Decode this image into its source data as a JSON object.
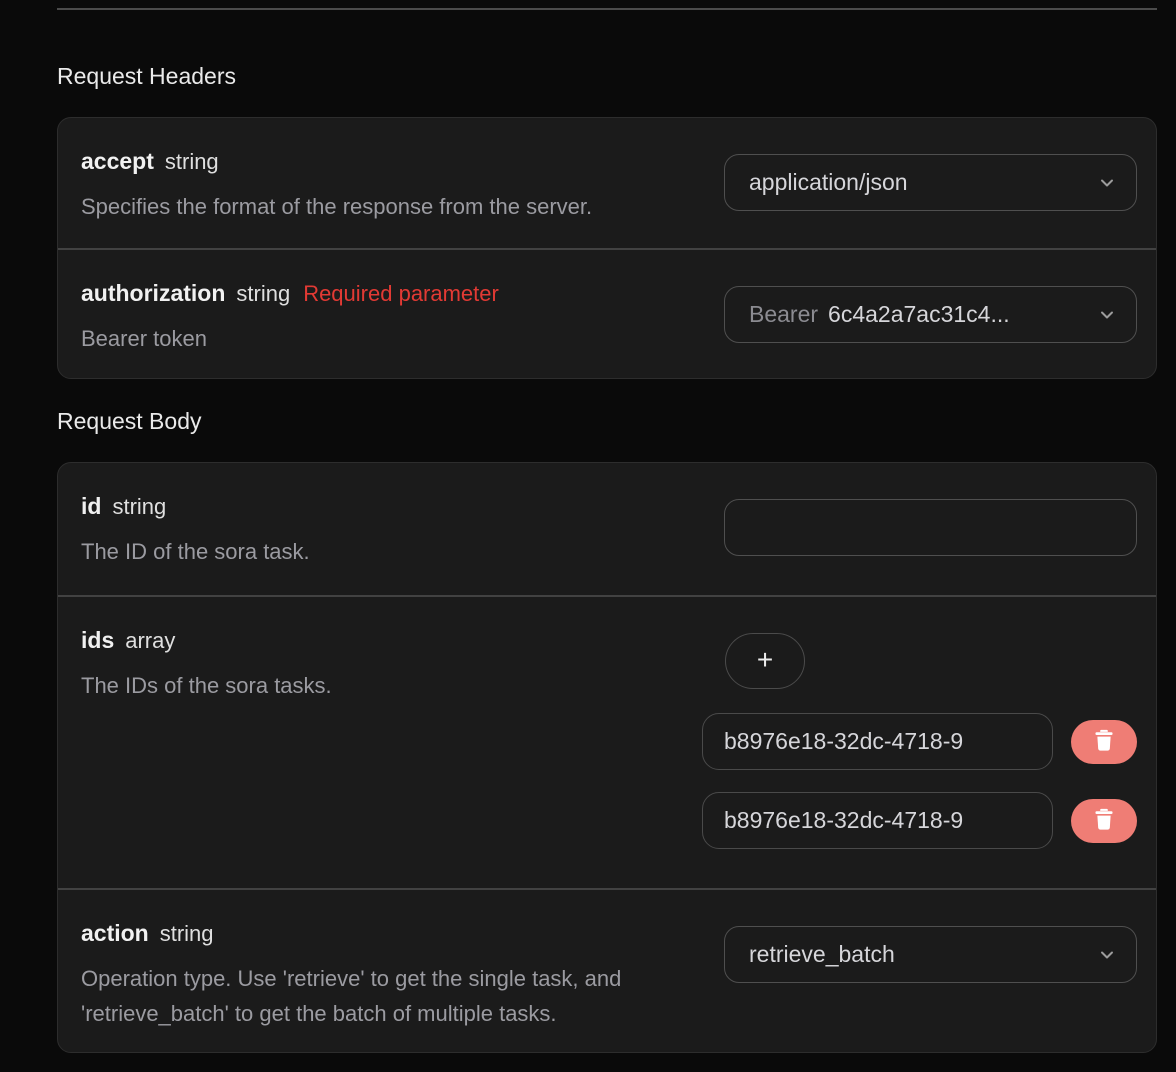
{
  "labels": {
    "request_headers": "Request Headers",
    "request_body": "Request Body"
  },
  "headers_fields": {
    "accept": {
      "name": "accept",
      "type": "string",
      "desc": "Specifies the format of the response from the server.",
      "value": "application/json"
    },
    "authorization": {
      "name": "authorization",
      "type": "string",
      "required": "Required parameter",
      "desc": "Bearer token",
      "prefix": "Bearer",
      "value": "6c4a2a7ac31c4..."
    }
  },
  "body_fields": {
    "id": {
      "name": "id",
      "type": "string",
      "desc": "The ID of the sora task.",
      "value": ""
    },
    "ids": {
      "name": "ids",
      "type": "array",
      "desc": "The IDs of the sora tasks.",
      "add_label": "+",
      "items": [
        "b8976e18-32dc-4718-9",
        "b8976e18-32dc-4718-9"
      ]
    },
    "action": {
      "name": "action",
      "type": "string",
      "desc": "Operation type. Use 'retrieve' to get the single task, and 'retrieve_batch' to get the batch of multiple tasks.",
      "value": "retrieve_batch"
    }
  },
  "colors": {
    "required_text": "#e23a34",
    "delete_button_bg": "#ef7d75",
    "card_bg": "#1b1b1b",
    "page_bg": "#0a0a0a"
  }
}
